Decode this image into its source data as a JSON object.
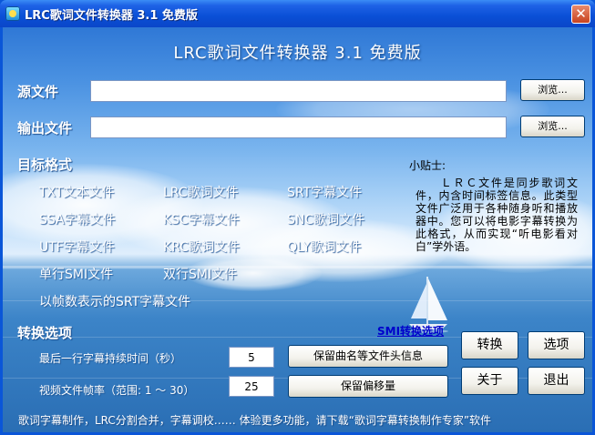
{
  "window": {
    "title": "LRC歌词文件转换器 3.1 免费版",
    "close_glyph": "✕"
  },
  "header": {
    "title": "LRC歌词文件转换器 3.1 免费版"
  },
  "source": {
    "label": "源文件",
    "value": "",
    "browse_label": "浏览..."
  },
  "output": {
    "label": "输出文件",
    "value": "",
    "browse_label": "浏览..."
  },
  "target": {
    "label": "目标格式",
    "formats": [
      "TXT文本文件",
      "LRC歌词文件",
      "SRT字幕文件",
      "SSA字幕文件",
      "KSC字幕文件",
      "SNC歌词文件",
      "UTF字幕文件",
      "KRC歌词文件",
      "QLY歌词文件",
      "单行SMI文件",
      "双行SMI文件",
      "以帧数表示的SRT字幕文件"
    ]
  },
  "tips": {
    "title": "小贴士:",
    "body": "　　ＬＲＣ文件是同步歌词文件，内含时间标签信息。此类型文件广泛用于各种随身听和播放器中。您可以将电影字幕转换为此格式，从而实现“听电影看对白”学外语。"
  },
  "convert_options": {
    "label": "转换选项",
    "smi_link": "SMI转换选项",
    "last_line_label": "最后一行字幕持续时间（秒）",
    "last_line_value": "5",
    "fps_label": "视频文件帧率（范围: 1 ～ 30）",
    "fps_value": "25",
    "keep_header_label": "保留曲名等文件头信息",
    "keep_offset_label": "保留偏移量"
  },
  "buttons": {
    "convert": "转换",
    "options": "选项",
    "about": "关于",
    "exit": "退出"
  },
  "footer": {
    "text": "歌词字幕制作，LRC分割合并，字幕调校…… 体验更多功能，请下载“歌词字幕转换制作专家”软件"
  },
  "icons": {
    "app": "app-icon",
    "close": "close-icon"
  }
}
